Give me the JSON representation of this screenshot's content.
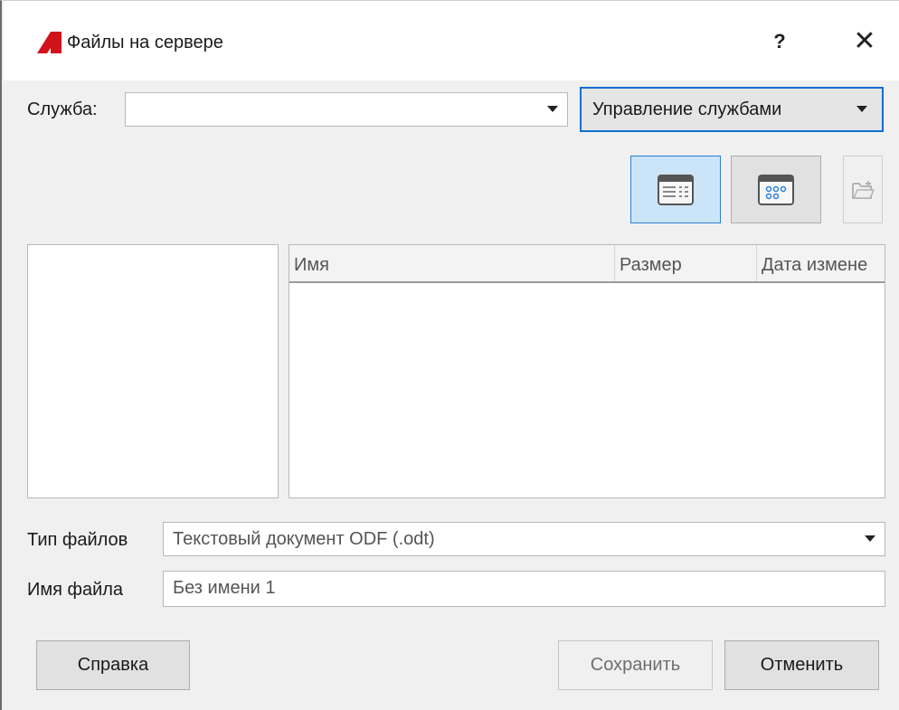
{
  "window": {
    "title": "Файлы на сервере",
    "help_label": "?",
    "close_label": "✕",
    "logo_color": "#d0121b"
  },
  "service": {
    "label": "Служба:",
    "value": "",
    "manage_label": "Управление службами"
  },
  "view_toolbar": {
    "list_view_icon": "details-view-icon",
    "icon_view_icon": "icons-view-icon",
    "new_folder_icon": "new-folder-icon",
    "active_color": "#cce4f7",
    "accent_color": "#2a7fd6"
  },
  "file_list": {
    "columns": [
      "Имя",
      "Размер",
      "Дата измене"
    ],
    "rows": []
  },
  "file_type": {
    "label": "Тип файлов",
    "value": "Текстовый документ ODF (.odt)"
  },
  "file_name": {
    "label": "Имя файла",
    "value": "Без имени 1"
  },
  "buttons": {
    "help": "Справка",
    "save": "Сохранить",
    "cancel": "Отменить"
  }
}
